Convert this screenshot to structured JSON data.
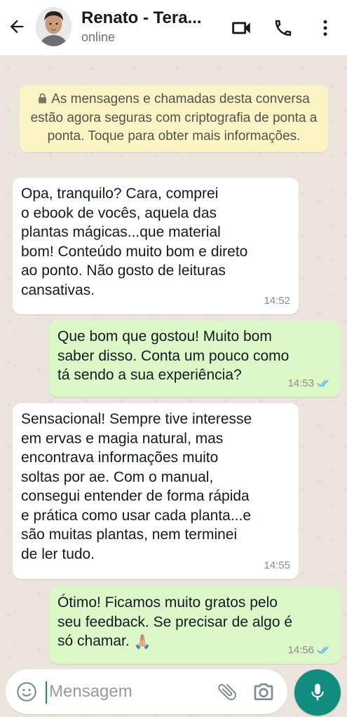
{
  "header": {
    "contact_name": "Renato - Tera...",
    "status": "online",
    "icons": {
      "back": "arrow-back-icon",
      "video": "video-call-icon",
      "call": "phone-icon",
      "menu": "more-vert-icon"
    }
  },
  "notice": {
    "icon": "lock-icon",
    "text": "As mensagens e chamadas desta conversa estão agora seguras com criptografia de ponta a ponta. Toque para obter mais informações."
  },
  "messages": [
    {
      "direction": "in",
      "text": "Opa, tranquilo? Cara, comprei\no ebook de vocês, aquela das\nplantas mágicas...que material\nbom! Conteúdo muito bom e direto\nao ponto. Não gosto de leituras\ncansativas.",
      "time": "14:52"
    },
    {
      "direction": "out",
      "text": "Que bom que gostou! Muito bom\nsaber disso. Conta um pouco como\ntá sendo a sua experiência?",
      "time": "14:53",
      "status": "read"
    },
    {
      "direction": "in",
      "text": "Sensacional! Sempre tive interesse\nem ervas e magia natural, mas\nencontrava informações muito\nsoltas por ae. Com o manual,\nconsegui entender de forma rápida\ne prática como usar cada planta...e\nsão muitas plantas, nem terminei\nde ler tudo.",
      "time": "14:55"
    },
    {
      "direction": "out",
      "text": "Ótimo! Ficamos muito gratos pelo\nseu feedback. Se precisar de algo é\nsó chamar.",
      "emoji": "🙏🏼",
      "time": "14:56",
      "status": "read"
    }
  ],
  "input": {
    "placeholder": "Mensagem",
    "value": ""
  },
  "colors": {
    "accent": "#128c7e",
    "outgoing_bubble": "#dcf8c6",
    "incoming_bubble": "#ffffff",
    "notice_bg": "#fdf4c5",
    "read_ticks": "#53bdeb",
    "chat_bg": "#ece5dd"
  }
}
